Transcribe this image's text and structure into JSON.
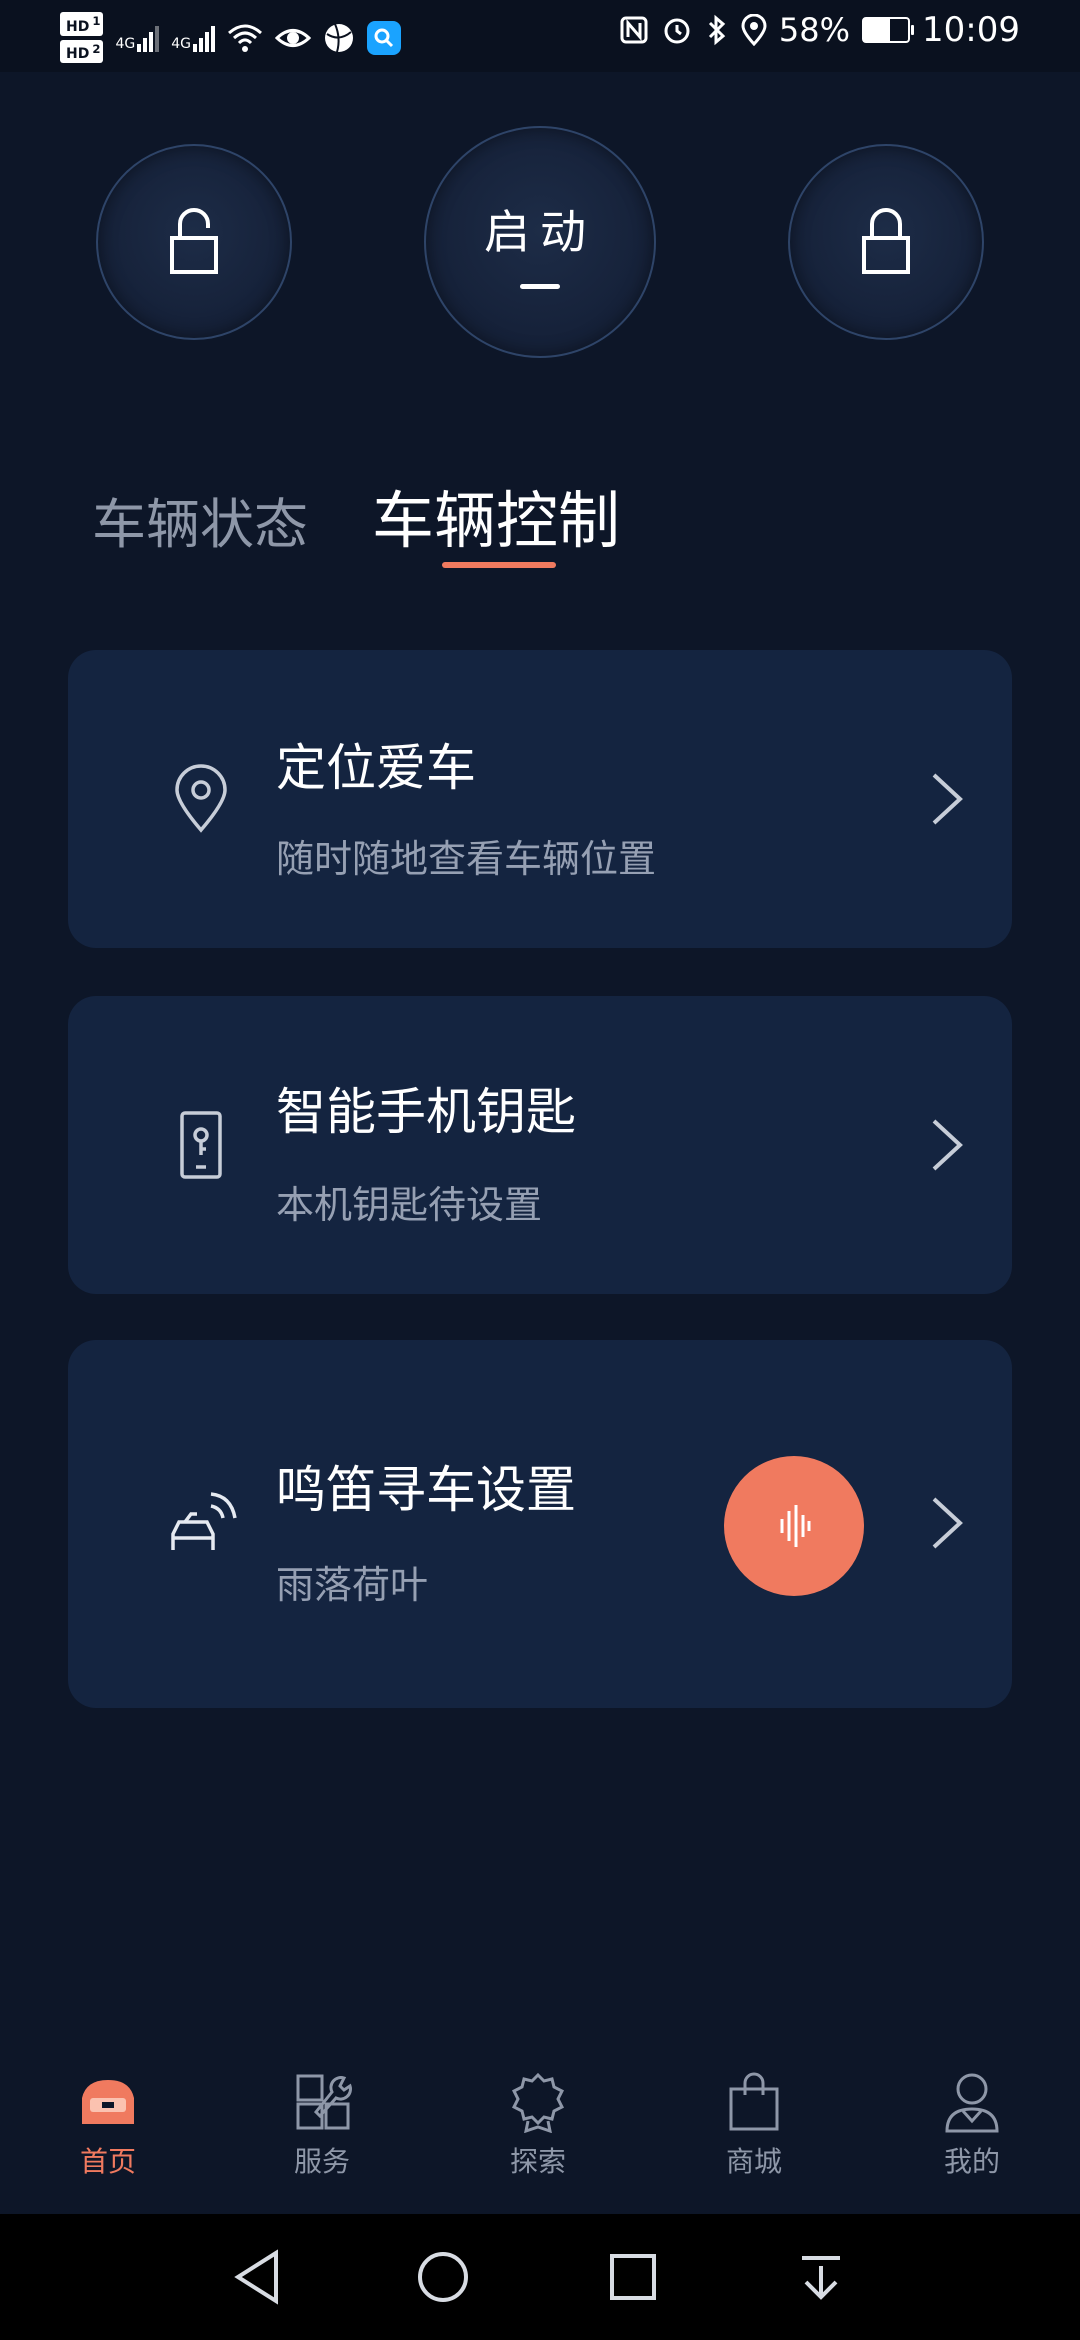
{
  "status_bar": {
    "hd1": "HD",
    "hd2": "HD",
    "hd1_num": "1",
    "hd2_num": "2",
    "net1": "4G",
    "net2": "4G",
    "battery_percent": "58%",
    "battery_level": 0.58,
    "time": "10:09"
  },
  "controls": {
    "unlock_icon": "unlock-icon",
    "start_label": "启动",
    "lock_icon": "lock-icon"
  },
  "tabs": {
    "status_label": "车辆状态",
    "control_label": "车辆控制",
    "active": "control"
  },
  "cards": [
    {
      "icon": "location-pin-icon",
      "title": "定位爱车",
      "subtitle": "随时随地查看车辆位置"
    },
    {
      "icon": "phone-key-icon",
      "title": "智能手机钥匙",
      "subtitle": "本机钥匙待设置"
    },
    {
      "icon": "car-signal-icon",
      "title": "鸣笛寻车设置",
      "subtitle": "雨落荷叶",
      "action_icon": "sound-wave-icon"
    }
  ],
  "bottom_nav": [
    {
      "label": "首页",
      "icon": "home-car-icon",
      "active": true
    },
    {
      "label": "服务",
      "icon": "wrench-icon",
      "active": false
    },
    {
      "label": "探索",
      "icon": "badge-icon",
      "active": false
    },
    {
      "label": "商城",
      "icon": "shopping-bag-icon",
      "active": false
    },
    {
      "label": "我的",
      "icon": "person-icon",
      "active": false
    }
  ],
  "colors": {
    "background": "#0d1628",
    "card": "#142440",
    "accent": "#f07a5f",
    "muted_text": "#8e97a8"
  }
}
